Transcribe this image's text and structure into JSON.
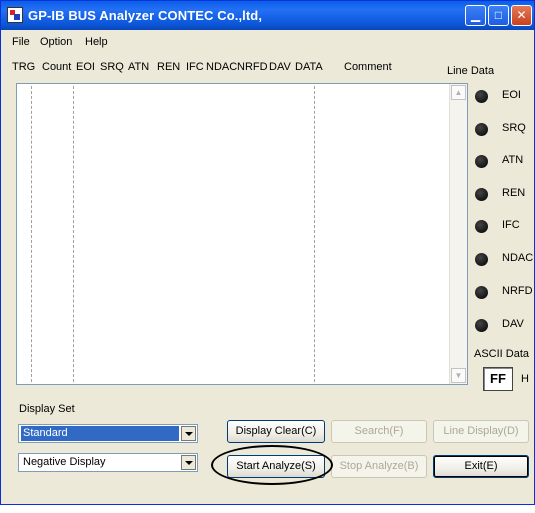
{
  "window": {
    "title": "GP-IB BUS Analyzer CONTEC Co.,ltd,"
  },
  "menu": [
    "File",
    "Option",
    "Help"
  ],
  "columns": [
    "TRG",
    "Count",
    "EOI",
    "SRQ",
    "ATN",
    "REN",
    "IFC",
    "NDAC",
    "NRFD",
    "DAV",
    "DATA",
    "Comment"
  ],
  "line_data": {
    "label": "Line Data",
    "lines": [
      "EOI",
      "SRQ",
      "ATN",
      "REN",
      "IFC",
      "NDAC",
      "NRFD",
      "DAV"
    ]
  },
  "ascii": {
    "label": "ASCII Data",
    "value": "FF",
    "suffix": "H"
  },
  "display_set": {
    "label": "Display Set",
    "mode_selected": "Standard",
    "polarity_selected": "Negative Display"
  },
  "buttons": {
    "display_clear": "Display Clear(C)",
    "search": "Search(F)",
    "line_display": "Line Display(D)",
    "start_analyze": "Start Analyze(S)",
    "stop_analyze": "Stop Analyze(B)",
    "exit": "Exit(E)"
  },
  "colors": {
    "title_bar": "#0a5ee8",
    "selection": "#316ac5",
    "led": "#000000"
  }
}
